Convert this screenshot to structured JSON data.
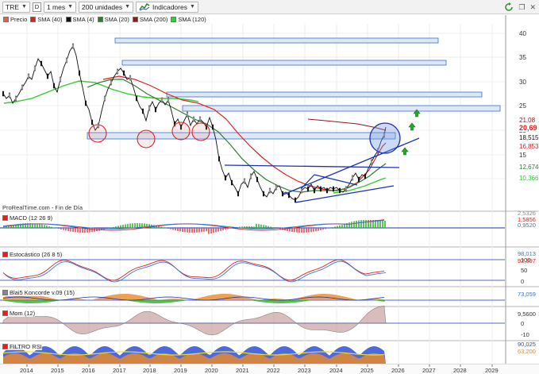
{
  "toolbar": {
    "ticker": "TRE",
    "period_btn": "D",
    "interval": "1 mes",
    "units": "200 unidades",
    "indicators": "Indicadores"
  },
  "legend": [
    {
      "label": "Precio",
      "color": "#e8604c"
    },
    {
      "label": "SMA (40)",
      "color": "#e02020"
    },
    {
      "label": "SMA (4)",
      "color": "#111111"
    },
    {
      "label": "SMA (20)",
      "color": "#2e7d32"
    },
    {
      "label": "SMA (200)",
      "color": "#8b1a1a"
    },
    {
      "label": "SMA (120)",
      "color": "#32cd32"
    }
  ],
  "source_label": "ProRealTime.com - Fin de Día",
  "price_axis": [
    "40",
    "35",
    "30",
    "25",
    "20",
    "15",
    "10"
  ],
  "price_tags": [
    {
      "text": "21,08",
      "color": "#8b1a1a"
    },
    {
      "text": "20,69",
      "color": "#e02020"
    },
    {
      "text": "18,515",
      "color": "#111111"
    },
    {
      "text": "16,853",
      "color": "#e02020"
    },
    {
      "text": "12,674",
      "color": "#2e7d32"
    },
    {
      "text": "10,366",
      "color": "#32cd32"
    }
  ],
  "panels": {
    "macd": {
      "title": "MACD (12 26 9)",
      "tags": [
        "2,5326",
        "1,5856",
        "0,9520"
      ]
    },
    "stoch": {
      "title": "Estocástico (26 8 5)",
      "tags": [
        "98,013",
        "92,397"
      ],
      "axis": [
        "100",
        "50",
        "0"
      ]
    },
    "blai5": {
      "title": "Blai5 Koncorde v.09 (15)",
      "tags": [
        "73,059"
      ]
    },
    "mom": {
      "title": "Mom (12)",
      "tags": [
        "9,5600"
      ],
      "axis": [
        "0",
        "-10"
      ]
    },
    "rsi": {
      "title": "FILTRO RSI",
      "tags": [
        "90,025",
        "63,200"
      ]
    }
  },
  "x_axis": [
    "2014",
    "2015",
    "2016",
    "2017",
    "2018",
    "2019",
    "2020",
    "2021",
    "2022",
    "2023",
    "2024",
    "2025",
    "2026",
    "2027",
    "2028",
    "2029"
  ]
}
